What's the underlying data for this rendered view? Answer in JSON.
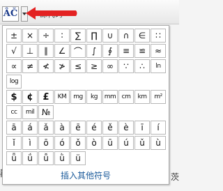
{
  "toolbar": {
    "symbol_button_label": "ÂČ",
    "next_label": "源代码"
  },
  "edge": {
    "left_text": "鹳",
    "right_text": "茨"
  },
  "symbols": [
    [
      "±",
      "×",
      "÷",
      "∶",
      "∑",
      "∏",
      "∪",
      "∩",
      "∈",
      "∷"
    ],
    [
      "√",
      "⊥",
      "∥",
      "∠",
      "⌒",
      "∫",
      "∮",
      "≡",
      "≌",
      "≈"
    ],
    [
      "∝",
      "≠",
      "≮",
      "≯",
      "≤",
      "≥",
      "∞",
      "∵",
      "∴",
      "ln"
    ],
    [
      "log"
    ],
    [
      "$",
      "¢",
      "£",
      "KM",
      "mg",
      "kg",
      "mm",
      "cm",
      "km",
      "m²"
    ],
    [
      "cc",
      "mil",
      "№"
    ],
    [
      "ā",
      "á",
      "ǎ",
      "à",
      "ē",
      "é",
      "ě",
      "è",
      "ī",
      "í"
    ],
    [
      "ǐ",
      "ì",
      "ō",
      "ó",
      "ǒ",
      "ò",
      "ū",
      "ú",
      "ǔ",
      "ù"
    ],
    [
      "ǖ",
      "ǘ",
      "ǚ",
      "ǜ",
      "ü"
    ]
  ],
  "more_link": "插入其他符号"
}
